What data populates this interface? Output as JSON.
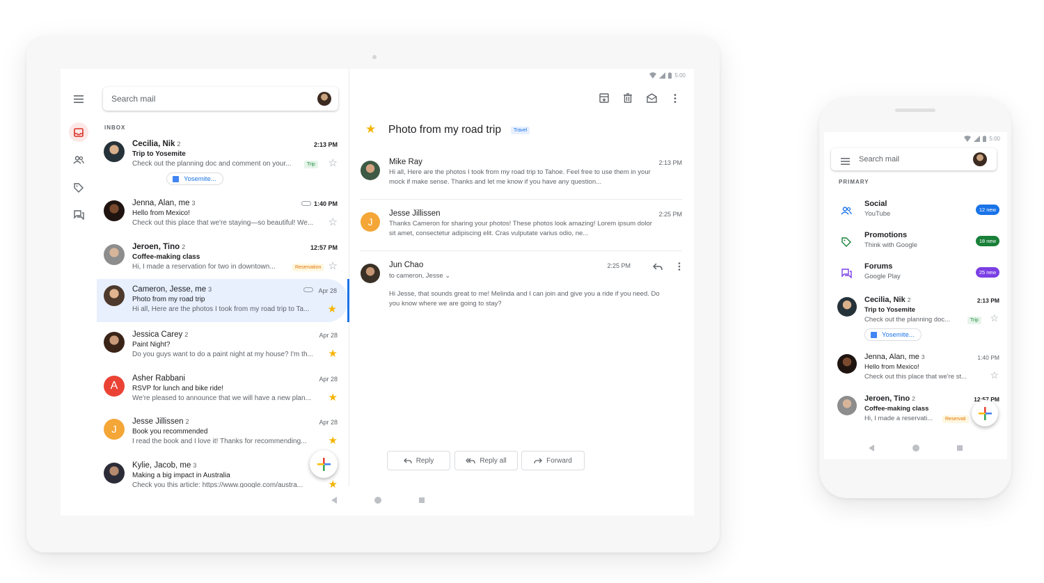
{
  "tablet": {
    "status_time": "5:00",
    "search_placeholder": "Search mail",
    "inbox_label": "INBOX",
    "mails": [
      {
        "sender": "Cecilia, Nik",
        "count": "2",
        "time": "2:13 PM",
        "subject": "Trip to Yosemite",
        "snippet": "Check out the planning doc and comment on your...",
        "chip": "Trip",
        "attachment": "Yosemite...",
        "unread": true,
        "starred": false
      },
      {
        "sender": "Jenna, Alan, me",
        "count": "3",
        "time": "1:40 PM",
        "subject": "Hello from Mexico!",
        "snippet": "Check out this place that we're staying—so beautiful! We...",
        "unread": false,
        "starred": false
      },
      {
        "sender": "Jeroen, Tino",
        "count": "2",
        "time": "12:57 PM",
        "subject": "Coffee-making class",
        "snippet": "Hi, I made a reservation for two in downtown...",
        "chip": "Reservation",
        "unread": true,
        "starred": false
      },
      {
        "sender": "Cameron, Jesse, me",
        "count": "3",
        "time": "Apr 28",
        "subject": "Photo from my road trip",
        "snippet": "Hi all, Here are the photos I took from my road trip to Ta...",
        "unread": false,
        "starred": true
      },
      {
        "sender": "Jessica Carey",
        "count": "2",
        "time": "Apr 28",
        "subject": "Paint Night?",
        "snippet": "Do you guys want to do a paint night at my house? I'm th...",
        "unread": false,
        "starred": true
      },
      {
        "sender": "Asher Rabbani",
        "count": "",
        "time": "Apr 28",
        "subject": "RSVP for lunch and bike ride!",
        "snippet": "We're pleased to announce that we will have a new plan...",
        "avatar_letter": "A",
        "unread": false,
        "starred": true
      },
      {
        "sender": "Jesse Jillissen",
        "count": "2",
        "time": "Apr 28",
        "subject": "Book you recommended",
        "snippet": "I read the book and I love it! Thanks for recommending...",
        "avatar_letter": "J",
        "unread": false,
        "starred": true
      },
      {
        "sender": "Kylie, Jacob, me",
        "count": "3",
        "time": "",
        "subject": "Making a big impact in Australia",
        "snippet": "Check you this article: https://www.google.com/austra...",
        "unread": false,
        "starred": true
      }
    ],
    "reader": {
      "title": "Photo from my road trip",
      "label": "Travel",
      "messages": [
        {
          "from": "Mike Ray",
          "time": "2:13 PM",
          "body": "Hi all, Here are the photos I took from my road trip to Tahoe. Feel free to use them in your mock if make sense. Thanks and let me know if you have any question..."
        },
        {
          "from": "Jesse Jillissen",
          "time": "2:25 PM",
          "body": "Thanks Cameron for sharing your photos! These photos look amazing! Lorem ipsum dolor sit amet, consectetur adipiscing elit. Cras vulputate varius odio, ne...",
          "avatar_letter": "J"
        },
        {
          "from": "Jun Chao",
          "time": "2:25 PM",
          "to": "to cameron, Jesse",
          "body": "Hi Jesse, that sounds great to me! Melinda and I can join and give you a ride if you need. Do you know where we are going to stay?"
        }
      ],
      "reply_label": "Reply",
      "reply_all_label": "Reply all",
      "forward_label": "Forward"
    }
  },
  "phone": {
    "status_time": "5:00",
    "search_placeholder": "Search mail",
    "primary_label": "PRIMARY",
    "categories": [
      {
        "name": "Social",
        "sub": "YouTube",
        "badge": "12 new",
        "color": "#1a73e8"
      },
      {
        "name": "Promotions",
        "sub": "Think with Google",
        "badge": "18 new",
        "color": "#188038"
      },
      {
        "name": "Forums",
        "sub": "Google Play",
        "badge": "25 new",
        "color": "#7b3fe4"
      }
    ],
    "mails": [
      {
        "sender": "Cecilia, Nik",
        "count": "2",
        "time": "2:13 PM",
        "subject": "Trip to Yosemite",
        "snippet": "Check out the planning doc...",
        "chip": "Trip",
        "attachment": "Yosemite..."
      },
      {
        "sender": "Jenna, Alan, me",
        "count": "3",
        "time": "1:40 PM",
        "subject": "Hello from Mexico!",
        "snippet": "Check out this place that we're st..."
      },
      {
        "sender": "Jeroen, Tino",
        "count": "2",
        "time": "12:57 PM",
        "subject": "Coffee-making class",
        "snippet": "Hi, I made a reservati...",
        "chip": "Reservati"
      }
    ]
  }
}
